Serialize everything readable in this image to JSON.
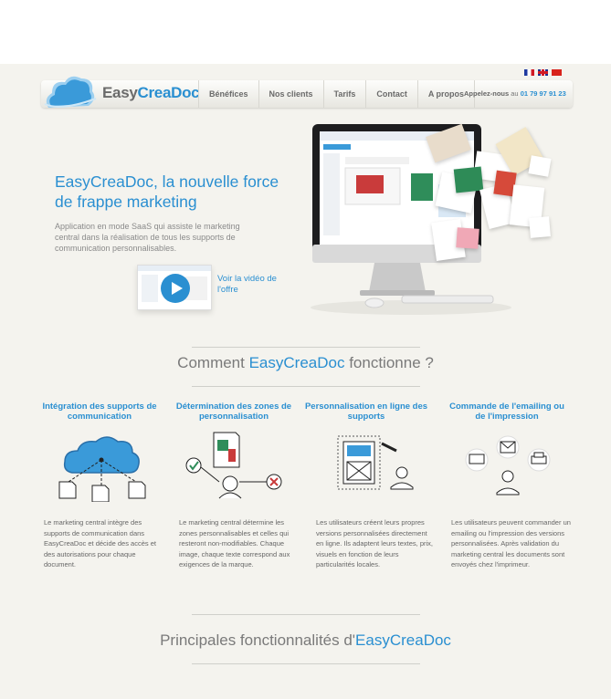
{
  "flags": {
    "fr": "French flag",
    "en": "English flag",
    "cn": "Chinese flag"
  },
  "brand": {
    "part1": "Easy",
    "part2": "CreaDoc",
    "accent": "#2a8fd1"
  },
  "nav": {
    "items": [
      {
        "label": "Bénéfices"
      },
      {
        "label": "Nos clients"
      },
      {
        "label": "Tarifs"
      },
      {
        "label": "Contact"
      },
      {
        "label": "A propos"
      }
    ]
  },
  "phone": {
    "label": "Appelez-nous",
    "sep": "au",
    "number": "01 79 97 91 23"
  },
  "hero": {
    "title": "EasyCreaDoc, la nouvelle force de frappe marketing",
    "description": "Application en mode SaaS qui assiste le marketing central dans la réalisation de tous les supports de communication personnalisables.",
    "video_link": "Voir la vidéo de l'offre"
  },
  "how": {
    "title_pre": "Comment ",
    "title_accent": "EasyCreaDoc",
    "title_post": " fonctionne ?",
    "steps": [
      {
        "title": "Intégration des supports de communication",
        "text": "Le marketing central intègre des supports de communication dans EasyCreaDoc et décide des accès et des autorisations pour chaque document."
      },
      {
        "title": "Détermination des zones de personnalisation",
        "text": "Le marketing central détermine les zones personnalisables et celles qui resteront non-modifiables. Chaque image, chaque texte correspond aux exigences de la marque."
      },
      {
        "title": "Personnalisation en ligne des supports",
        "text": "Les utilisateurs créent leurs propres versions personnalisées directement en ligne. Ils adaptent leurs textes, prix, visuels en fonction de leurs particularités locales."
      },
      {
        "title": "Commande de l'emailing ou de l'impression",
        "text": "Les utilisateurs peuvent commander un emailing ou l'impression des versions personnalisées. Après validation du marketing central les documents sont envoyés chez l'imprimeur."
      }
    ]
  },
  "features": {
    "title_pre": "Principales fonctionnalités d'",
    "title_accent": "EasyCreaDoc"
  }
}
